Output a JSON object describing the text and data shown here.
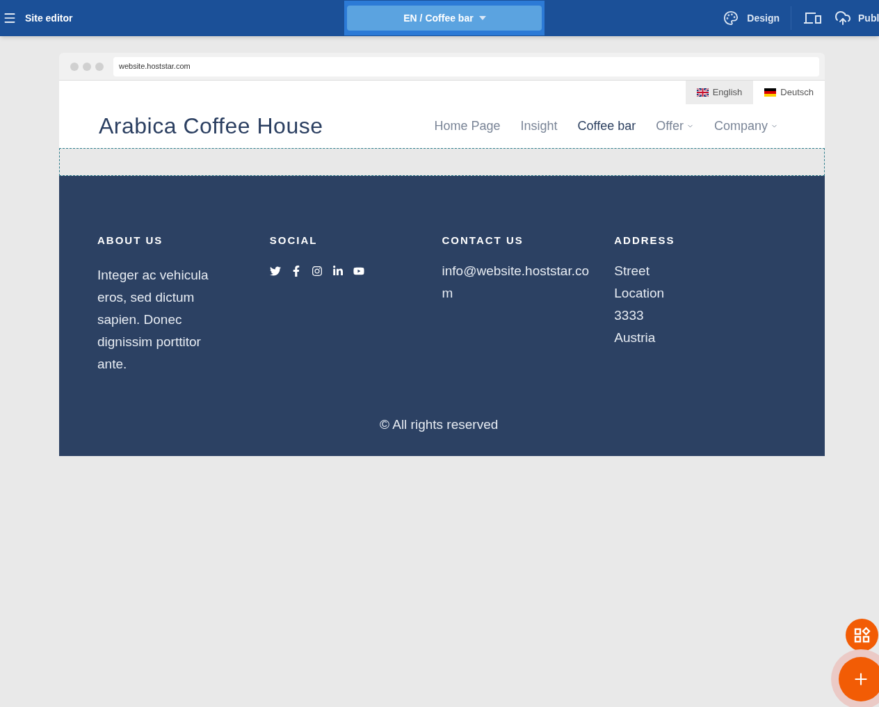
{
  "toolbar": {
    "title": "Site editor",
    "page_selector": "EN / Coffee bar",
    "design": "Design",
    "publish": "Publ"
  },
  "browser": {
    "url": "website.hoststar.com"
  },
  "languages": [
    {
      "label": "English",
      "kind": "uk",
      "selected": true
    },
    {
      "label": "Deutsch",
      "kind": "de",
      "selected": false
    }
  ],
  "site": {
    "logo": "Arabica Coffee House",
    "nav": [
      {
        "label": "Home Page",
        "selected": false,
        "dropdown": false
      },
      {
        "label": "Insight",
        "selected": false,
        "dropdown": false
      },
      {
        "label": "Coffee bar",
        "selected": true,
        "dropdown": false
      },
      {
        "label": "Offer",
        "selected": false,
        "dropdown": true
      },
      {
        "label": "Company",
        "selected": false,
        "dropdown": true
      }
    ]
  },
  "footer": {
    "columns": [
      {
        "heading": "ABOUT US",
        "kind": "text",
        "text": "Integer ac vehicula eros, sed dictum sapien. Donec dignissim porttitor ante."
      },
      {
        "heading": "SOCIAL",
        "kind": "social"
      },
      {
        "heading": "CONTACT US",
        "kind": "email",
        "text": "info@website.hoststar.com"
      },
      {
        "heading": "ADDRESS",
        "kind": "lines",
        "lines": [
          "Street",
          "Location",
          "3333",
          "Austria"
        ]
      }
    ],
    "copyright": "© All rights reserved"
  }
}
